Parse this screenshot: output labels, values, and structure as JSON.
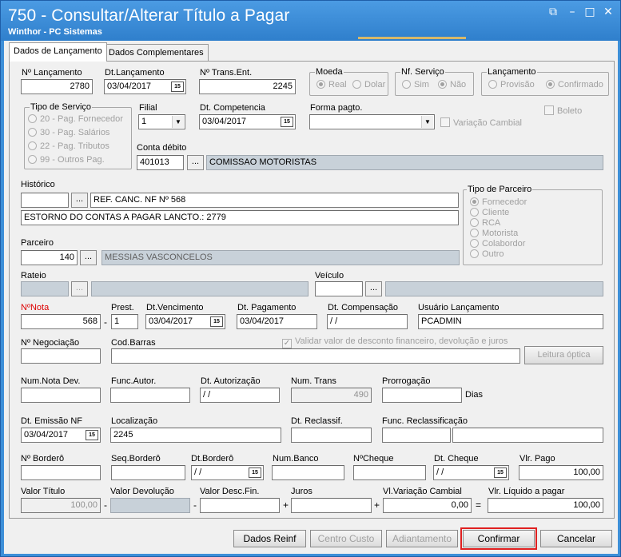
{
  "window": {
    "title": "750 - Consultar/Alterar Título a Pagar",
    "subtitle": "Winthor - PC Sistemas",
    "icons": [
      "restore-icon",
      "minimize-icon",
      "maximize-icon",
      "close-icon"
    ]
  },
  "tabs": [
    "Dados de Lançamento",
    "Dados Complementares"
  ],
  "lancamento": {
    "num_label": "Nº Lançamento",
    "num": "2780",
    "dt_label": "Dt.Lançamento",
    "dt": "03/04/2017",
    "trans_label": "Nº Trans.Ent.",
    "trans": "2245"
  },
  "moeda": {
    "title": "Moeda",
    "options": [
      "Real",
      "Dolar"
    ]
  },
  "nf_servico": {
    "title": "Nf. Serviço",
    "options": [
      "Sim",
      "Não"
    ]
  },
  "tipo_lancamento": {
    "title": "Lançamento",
    "options": [
      "Provisão",
      "Confirmado"
    ]
  },
  "tipo_servico": {
    "title": "Tipo de Serviço",
    "options": [
      "20 - Pag. Fornecedor",
      "30 - Pag. Salários",
      "22 - Pag. Tributos",
      "99 - Outros Pag."
    ]
  },
  "filial": {
    "label": "Filial",
    "value": "1"
  },
  "competencia": {
    "label": "Dt. Competencia",
    "value": "03/04/2017"
  },
  "forma_pagto": {
    "label": "Forma pagto.",
    "value": ""
  },
  "boleto": "Boleto",
  "variacao_cambial_chk": "Variação Cambial",
  "conta_debito": {
    "label": "Conta débito",
    "code": "401013",
    "name": "COMISSAO MOTORISTAS"
  },
  "historico": {
    "label": "Histórico",
    "line1": "REF. CANC. NF Nº 568",
    "line2": "ESTORNO DO CONTAS A PAGAR LANCTO.: 2779"
  },
  "tipo_parceiro": {
    "title": "Tipo de Parceiro",
    "options": [
      "Fornecedor",
      "Cliente",
      "RCA",
      "Motorista",
      "Colabordor",
      "Outro"
    ]
  },
  "parceiro": {
    "label": "Parceiro",
    "code": "140",
    "name": "MESSIAS VASCONCELOS"
  },
  "rateio": {
    "label": "Rateio"
  },
  "veiculo": {
    "label": "Veículo"
  },
  "row_nota": {
    "nota_label": "NºNota",
    "nota": "568",
    "prest_label": "Prest.",
    "prest": "1",
    "venc_label": "Dt.Vencimento",
    "venc": "03/04/2017",
    "pag_label": "Dt. Pagamento",
    "pag": "03/04/2017",
    "comp_label": "Dt. Compensação",
    "comp": " / /",
    "usuario_label": "Usuário Lançamento",
    "usuario": "PCADMIN"
  },
  "negociacao_label": "Nº Negociação",
  "codbarras_label": "Cod.Barras",
  "validar_desconto": "Validar valor de desconto financeiro,  devolução e juros",
  "leitura_optica": "Leitura óptica",
  "row_dev": {
    "num_nota_dev": "Num.Nota Dev.",
    "func_autor": "Func.Autor.",
    "dt_autorizacao": "Dt. Autorização",
    "dt_autorizacao_val": " / /",
    "num_trans": "Num. Trans",
    "num_trans_val": "490",
    "prorrogacao": "Prorrogação",
    "dias": "Dias"
  },
  "row_emissao": {
    "dt_emissao_label": "Dt. Emissão NF",
    "dt_emissao": "03/04/2017",
    "localizacao_label": "Localização",
    "localizacao": "2245",
    "dt_reclassif": "Dt. Reclassif.",
    "func_reclass": "Func. Reclassificação"
  },
  "row_bordero": {
    "num_bordero": "Nº Borderô",
    "seq_bordero": "Seq.Borderô",
    "dt_bordero": "Dt.Borderô",
    "dt_bordero_val": " / /",
    "num_banco": "Num.Banco",
    "num_cheque": "NºCheque",
    "dt_cheque": "Dt. Cheque",
    "dt_cheque_val": " / /",
    "vlr_pago": "Vlr. Pago",
    "vlr_pago_val": "100,00"
  },
  "row_valor": {
    "valor_titulo": "Valor Título",
    "valor_titulo_val": "100,00",
    "valor_devolucao": "Valor Devolução",
    "valor_desc": "Valor Desc.Fin.",
    "juros": "Juros",
    "variacao": "Vl.Variação Cambial",
    "variacao_val": "0,00",
    "liquido": "Vlr. Líquido a pagar",
    "liquido_val": "100,00",
    "ops": [
      "-",
      "-",
      "+",
      "+",
      "="
    ]
  },
  "footer": {
    "dados_reinf": "Dados Reinf",
    "centro_custo": "Centro Custo",
    "adiantamento": "Adiantamento",
    "confirmar": "Confirmar",
    "cancelar": "Cancelar"
  }
}
